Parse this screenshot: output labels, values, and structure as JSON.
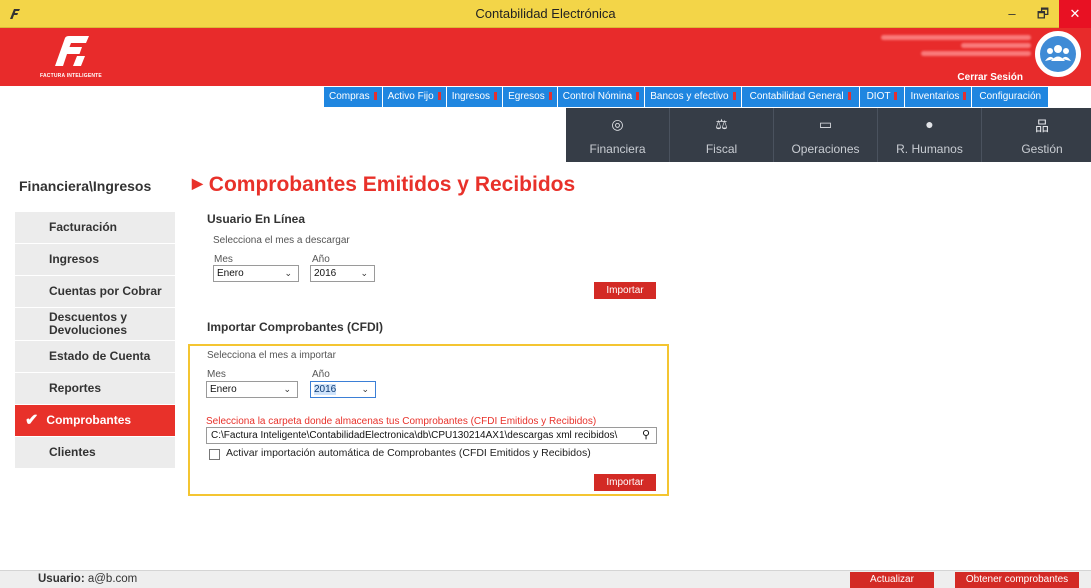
{
  "window": {
    "title": "Contabilidad Electrónica",
    "controls": {
      "minimize": "–",
      "maximize": "🗗",
      "close": "✕"
    }
  },
  "header": {
    "logo_text": "FACTURA INTELIGENTE",
    "logout_label": "Cerrar Sesión",
    "avatar_icon": "users-group-icon",
    "brand_color": "#e82b2b"
  },
  "menu": {
    "items": [
      {
        "label": "Compras",
        "flag": true
      },
      {
        "label": "Activo Fijo",
        "flag": true
      },
      {
        "label": "Ingresos",
        "flag": true
      },
      {
        "label": "Egresos",
        "flag": true
      },
      {
        "label": "Control Nómina",
        "flag": true
      },
      {
        "label": "Bancos y efectivo",
        "flag": true
      },
      {
        "label": "Contabilidad General",
        "flag": true
      },
      {
        "label": "DIOT",
        "flag": true
      },
      {
        "label": "Inventarios",
        "flag": true
      },
      {
        "label": "Configuración",
        "flag": false
      }
    ],
    "color": "#1f86e0"
  },
  "tabs": [
    {
      "label": "Financiera",
      "icon": "coins-icon",
      "glyph": "◎"
    },
    {
      "label": "Fiscal",
      "icon": "scale-icon",
      "glyph": "⚖"
    },
    {
      "label": "Operaciones",
      "icon": "monitor-icon",
      "glyph": "▭"
    },
    {
      "label": "R. Humanos",
      "icon": "person-icon",
      "glyph": "●"
    },
    {
      "label": "Gestión",
      "icon": "org-chart-icon",
      "glyph": "品"
    }
  ],
  "breadcrumb": "Financiera\\Ingresos",
  "page_title": "Comprobantes Emitidos y Recibidos",
  "sidebar": {
    "items": [
      {
        "label": "Facturación",
        "active": false
      },
      {
        "label": "Ingresos",
        "active": false
      },
      {
        "label": "Cuentas por Cobrar",
        "active": false
      },
      {
        "label": "Descuentos y Devoluciones",
        "active": false
      },
      {
        "label": "Estado de Cuenta",
        "active": false
      },
      {
        "label": "Reportes",
        "active": false
      },
      {
        "label": "Comprobantes",
        "active": true
      },
      {
        "label": "Clientes",
        "active": false
      }
    ]
  },
  "online": {
    "title": "Usuario En Línea",
    "hint": "Selecciona el mes a descargar",
    "mes_label": "Mes",
    "mes_value": "Enero",
    "anio_label": "Año",
    "anio_value": "2016",
    "button": "Importar"
  },
  "cfdi": {
    "title": "Importar Comprobantes (CFDI)",
    "hint": "Selecciona el mes a importar",
    "mes_label": "Mes",
    "mes_value": "Enero",
    "anio_label": "Año",
    "anio_value": "2016",
    "folder_hint": "Selecciona la carpeta donde almacenas tus Comprobantes (CFDI Emitidos y Recibidos)",
    "folder_path": "C:\\Factura Inteligente\\ContabilidadElectronica\\db\\CPU130214AX1\\descargas xml recibidos\\",
    "auto_import_label": "Activar importación automática de Comprobantes (CFDI Emitidos y Recibidos)",
    "auto_import_checked": false,
    "button": "Importar"
  },
  "footer": {
    "user_label": "Usuario:",
    "user_value": "a@b.com",
    "refresh_button": "Actualizar",
    "fetch_button": "Obtener comprobantes"
  }
}
